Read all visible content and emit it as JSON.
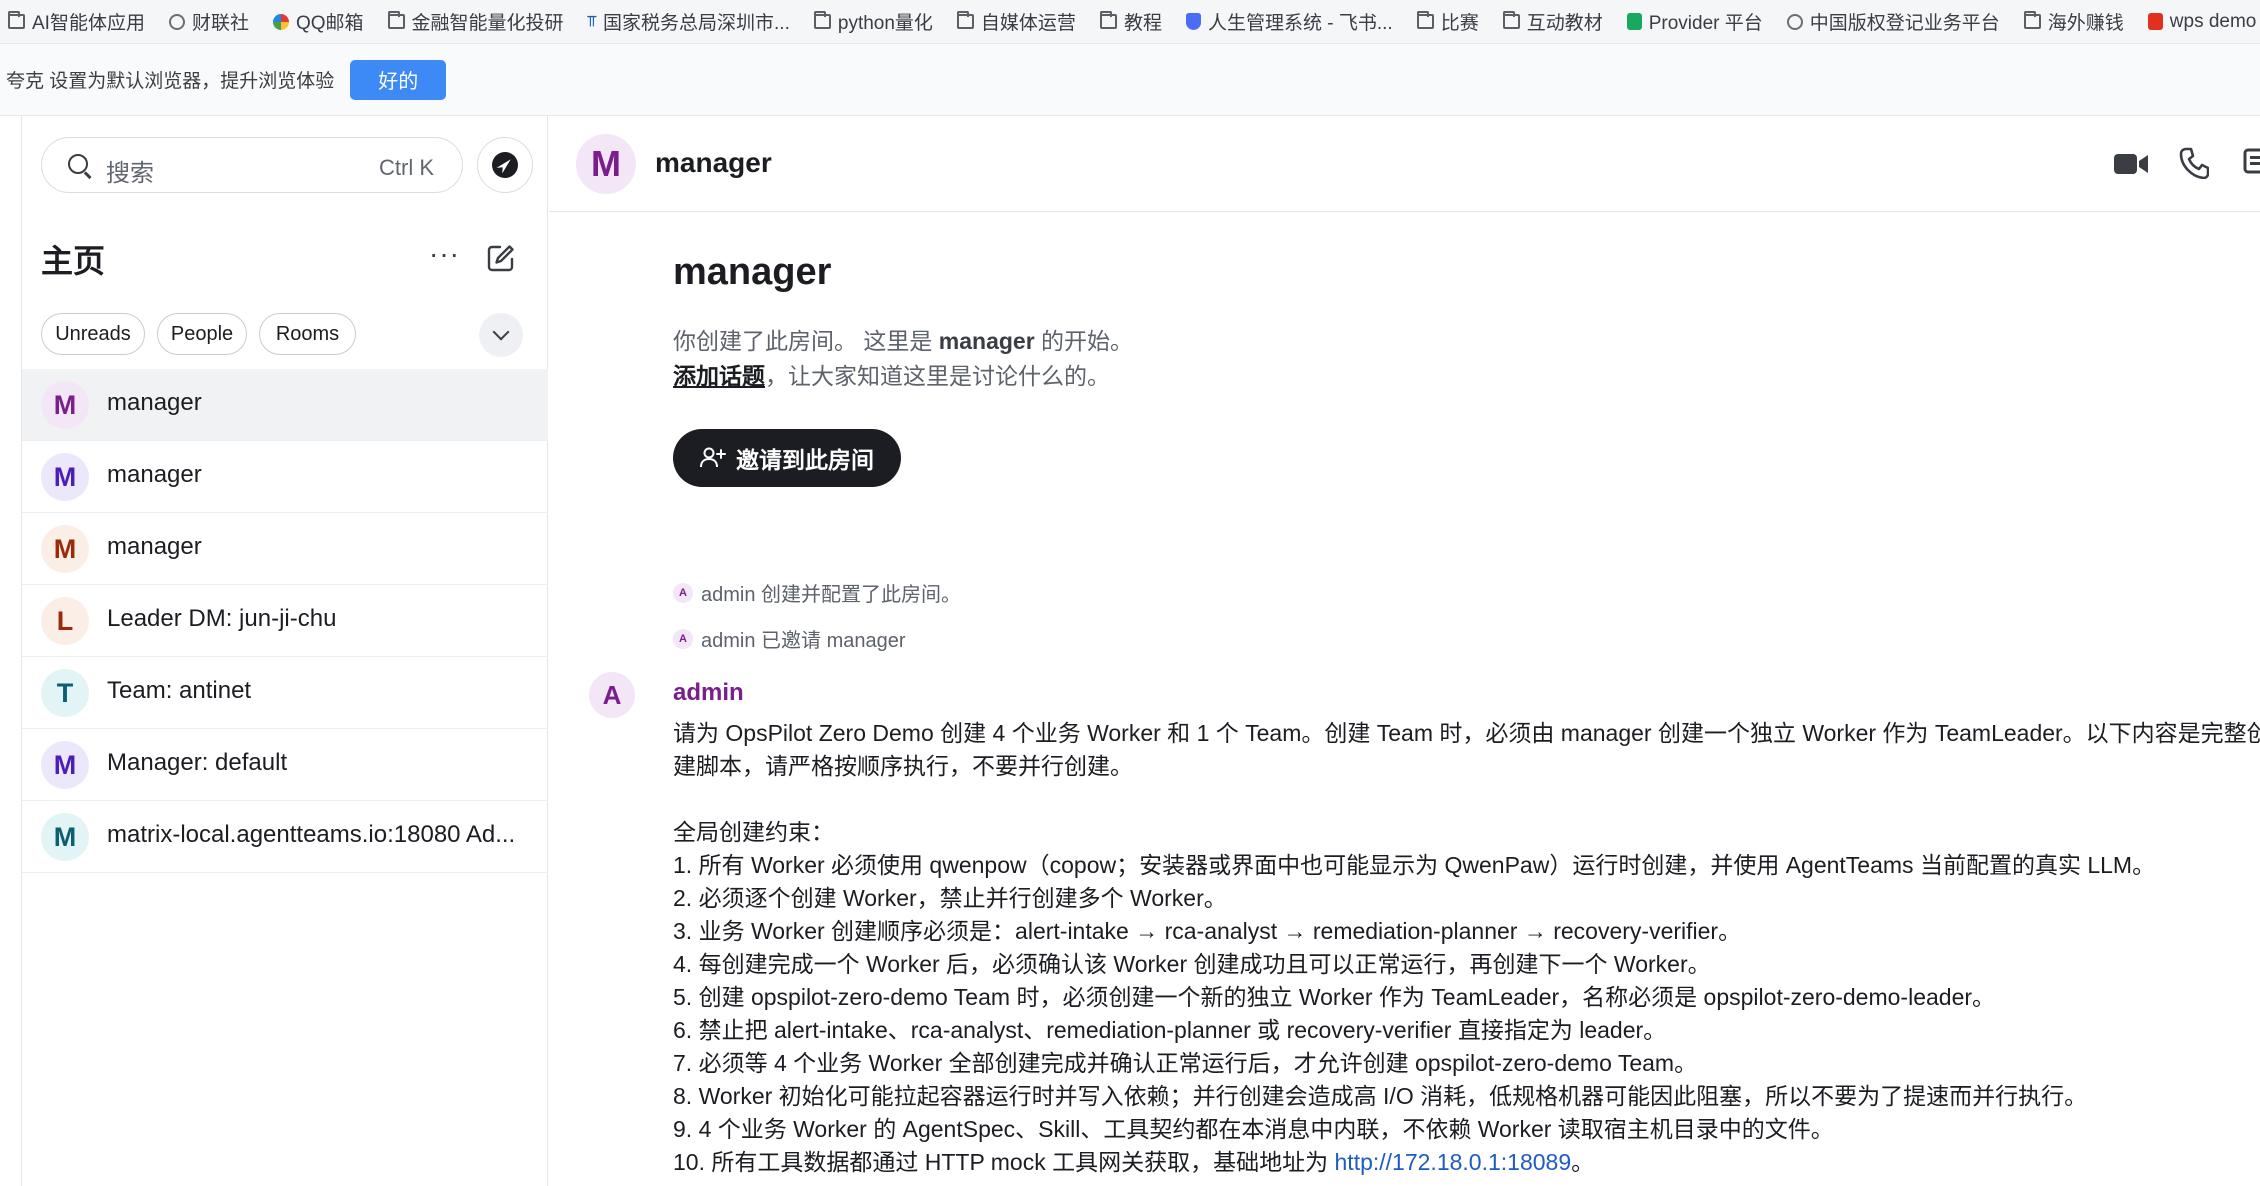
{
  "bookmarks": [
    {
      "label": "AI智能体应用",
      "icon": "folder-icon"
    },
    {
      "label": "财联社",
      "icon": "globe-icon"
    },
    {
      "label": "QQ邮箱",
      "icon": "qq-icon"
    },
    {
      "label": "金融智能量化投研",
      "icon": "folder-icon"
    },
    {
      "label": "国家税务总局深圳市...",
      "icon": "tax-icon"
    },
    {
      "label": "python量化",
      "icon": "folder-icon"
    },
    {
      "label": "自媒体运营",
      "icon": "folder-icon"
    },
    {
      "label": "教程",
      "icon": "folder-icon"
    },
    {
      "label": "人生管理系统 - 飞书...",
      "icon": "shield-icon"
    },
    {
      "label": "比赛",
      "icon": "folder-icon"
    },
    {
      "label": "互动教材",
      "icon": "folder-icon"
    },
    {
      "label": "Provider 平台",
      "icon": "sheet-icon"
    },
    {
      "label": "中国版权登记业务平台",
      "icon": "globe-icon"
    },
    {
      "label": "海外赚钱",
      "icon": "folder-icon"
    },
    {
      "label": "wps demo",
      "icon": "wps-icon"
    }
  ],
  "banner": {
    "text": "夸克 设置为默认浏览器，提升浏览体验",
    "ok_label": "好的"
  },
  "sidebar": {
    "search_placeholder": "搜索",
    "search_shortcut": "Ctrl K",
    "home_title": "主页",
    "more_label": "···",
    "filters": [
      "Unreads",
      "People",
      "Rooms"
    ],
    "rooms": [
      {
        "initial": "M",
        "name": "manager",
        "bg": "#f2e6f7",
        "fg": "#7a1e8c",
        "active": true
      },
      {
        "initial": "M",
        "name": "manager",
        "bg": "#ece8fb",
        "fg": "#4a1fb8",
        "active": false
      },
      {
        "initial": "M",
        "name": "manager",
        "bg": "#fbeee6",
        "fg": "#9c2a08",
        "active": false
      },
      {
        "initial": "L",
        "name": "Leader DM: jun-ji-chu",
        "bg": "#fbeee6",
        "fg": "#9c2a08",
        "active": false
      },
      {
        "initial": "T",
        "name": "Team: antinet",
        "bg": "#e3f4f6",
        "fg": "#0b5f72",
        "active": false
      },
      {
        "initial": "M",
        "name": "Manager: default",
        "bg": "#ece8fb",
        "fg": "#4a1fb8",
        "active": false
      },
      {
        "initial": "M",
        "name": "matrix-local.agentteams.io:18080 Ad...",
        "bg": "#e3f4f6",
        "fg": "#0b5f72",
        "active": false
      }
    ]
  },
  "main": {
    "header": {
      "initial": "M",
      "title": "manager"
    },
    "intro": {
      "title": "manager",
      "line1_pre": "你创建了此房间。 这里是 ",
      "line1_room": "manager",
      "line1_post": " 的开始。",
      "add_topic": "添加话题",
      "line2_post": "，让大家知道这里是讨论什么的。",
      "invite_label": "邀请到此房间"
    },
    "events": [
      {
        "initial": "A",
        "text": "admin 创建并配置了此房间。"
      },
      {
        "initial": "A",
        "text": "admin 已邀请 manager"
      }
    ],
    "message": {
      "sender_initial": "A",
      "sender": "admin",
      "line_1": "请为 OpsPilot Zero Demo 创建 4 个业务 Worker 和 1 个 Team。创建 Team 时，必须由 manager 创建一个独立 Worker 作为 TeamLeader。以下内容是完整创",
      "line_2": "建脚本，请严格按顺序执行，不要并行创建。",
      "constraints_title": "全局创建约束：",
      "items": [
        "1. 所有 Worker 必须使用 qwenpow（copow；安装器或界面中也可能显示为 QwenPaw）运行时创建，并使用 AgentTeams 当前配置的真实 LLM。",
        "2. 必须逐个创建 Worker，禁止并行创建多个 Worker。",
        "3. 业务 Worker 创建顺序必须是：alert-intake → rca-analyst → remediation-planner → recovery-verifier。",
        "4. 每创建完成一个 Worker 后，必须确认该 Worker 创建成功且可以正常运行，再创建下一个 Worker。",
        "5. 创建 opspilot-zero-demo Team 时，必须创建一个新的独立 Worker 作为 TeamLeader，名称必须是 opspilot-zero-demo-leader。",
        "6. 禁止把 alert-intake、rca-analyst、remediation-planner 或 recovery-verifier 直接指定为 leader。",
        "7. 必须等 4 个业务 Worker 全部创建完成并确认正常运行后，才允许创建 opspilot-zero-demo Team。",
        "8. Worker 初始化可能拉起容器运行时并写入依赖；并行创建会造成高 I/O 消耗，低规格机器可能因此阻塞，所以不要为了提速而并行执行。",
        "9. 4 个业务 Worker 的 AgentSpec、Skill、工具契约都在本消息中内联，不依赖 Worker 读取宿主机目录中的文件。"
      ],
      "item_10_pre": "10. 所有工具数据都通过 HTTP mock 工具网关获取，基础地址为 ",
      "item_10_link": "http://172.18.0.1:18089",
      "item_10_post": "。"
    }
  }
}
